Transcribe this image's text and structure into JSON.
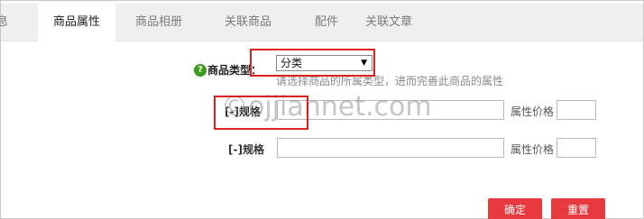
{
  "tabs": [
    "息息",
    "商品属性",
    "商品相册",
    "关联商品",
    "配件",
    "关联文章"
  ],
  "goods_type": {
    "label": "商品类型：",
    "selected": "分类",
    "hint": "请选择商品的所属类型，进而完善此商品的属性"
  },
  "specs": [
    {
      "toggle_label": "[-]规格",
      "price_label": "属性价格"
    },
    {
      "toggle_label": "[-]规格",
      "price_label": "属性价格"
    }
  ],
  "watermark": "©ojjiannet.com",
  "buttons": {
    "ok": "确定",
    "reset": "重置"
  },
  "colors": {
    "accent": "#e8393f",
    "annotation": "#e02020",
    "help": "#3c9a1d"
  }
}
